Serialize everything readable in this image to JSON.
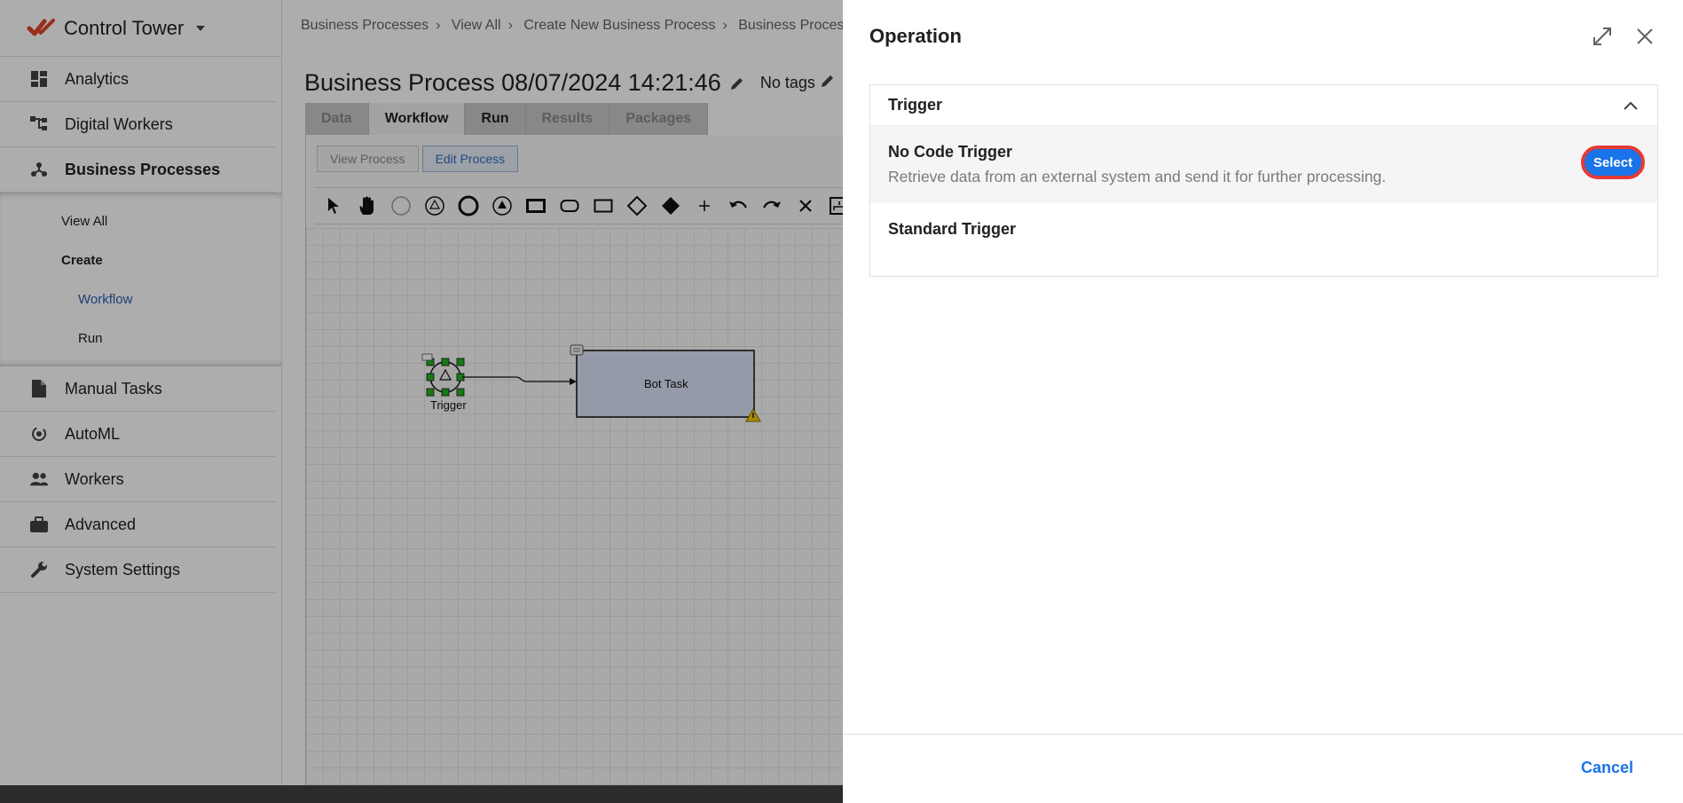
{
  "sidebar": {
    "brand": "Control Tower",
    "items_top": [
      {
        "label": "Analytics",
        "icon": "dashboard-icon"
      },
      {
        "label": "Digital Workers",
        "icon": "hierarchy-icon"
      },
      {
        "label": "Business Processes",
        "icon": "process-icon"
      }
    ],
    "sub": {
      "view_all": "View All",
      "create": "Create",
      "workflow": "Workflow",
      "run": "Run"
    },
    "items_bottom": [
      {
        "label": "Manual Tasks",
        "icon": "document-icon"
      },
      {
        "label": "AutoML",
        "icon": "automl-icon"
      },
      {
        "label": "Workers",
        "icon": "people-icon"
      },
      {
        "label": "Advanced",
        "icon": "briefcase-icon"
      },
      {
        "label": "System Settings",
        "icon": "wrench-icon"
      }
    ]
  },
  "main": {
    "breadcrumb": [
      "Business Processes",
      "View All",
      "Create New Business Process",
      "Business Proces"
    ],
    "title": "Business Process 08/07/2024 14:21:46",
    "tags": "No tags",
    "tabs": [
      "Data",
      "Workflow",
      "Run",
      "Results",
      "Packages"
    ],
    "subtabs": [
      "View Process",
      "Edit Process"
    ],
    "diagram": {
      "trigger_label": "Trigger",
      "task_label": "Bot Task"
    }
  },
  "panel": {
    "title": "Operation",
    "section": "Trigger",
    "options": [
      {
        "title": "No Code Trigger",
        "desc": "Retrieve data from an external system and send it for further processing.",
        "button": "Select"
      },
      {
        "title": "Standard Trigger",
        "desc": ""
      }
    ],
    "cancel": "Cancel"
  },
  "colors": {
    "accent": "#1a73e8",
    "brand": "#e0442a",
    "highlight_ring": "#e53935"
  }
}
